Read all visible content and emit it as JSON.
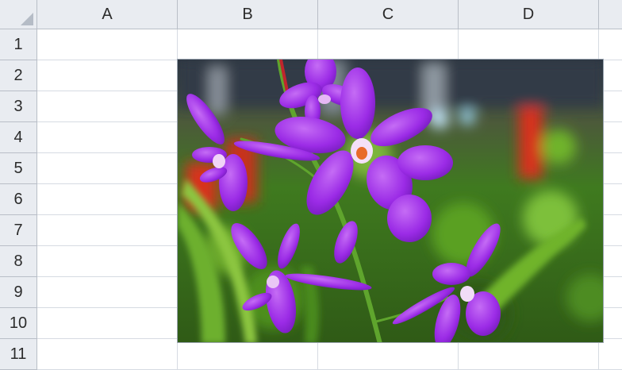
{
  "sheet": {
    "columns": [
      "A",
      "B",
      "C",
      "D"
    ],
    "rows": [
      "1",
      "2",
      "3",
      "4",
      "5",
      "6",
      "7",
      "8",
      "9",
      "10",
      "11"
    ]
  },
  "picture": {
    "subject": "purple orchid flowers with green blurred background",
    "colors": {
      "petal": "#9b2be6",
      "petal_light": "#c56cf5",
      "stem": "#5fa52d",
      "background_green": "#3f7a1f",
      "background_red": "#d8331c"
    }
  }
}
